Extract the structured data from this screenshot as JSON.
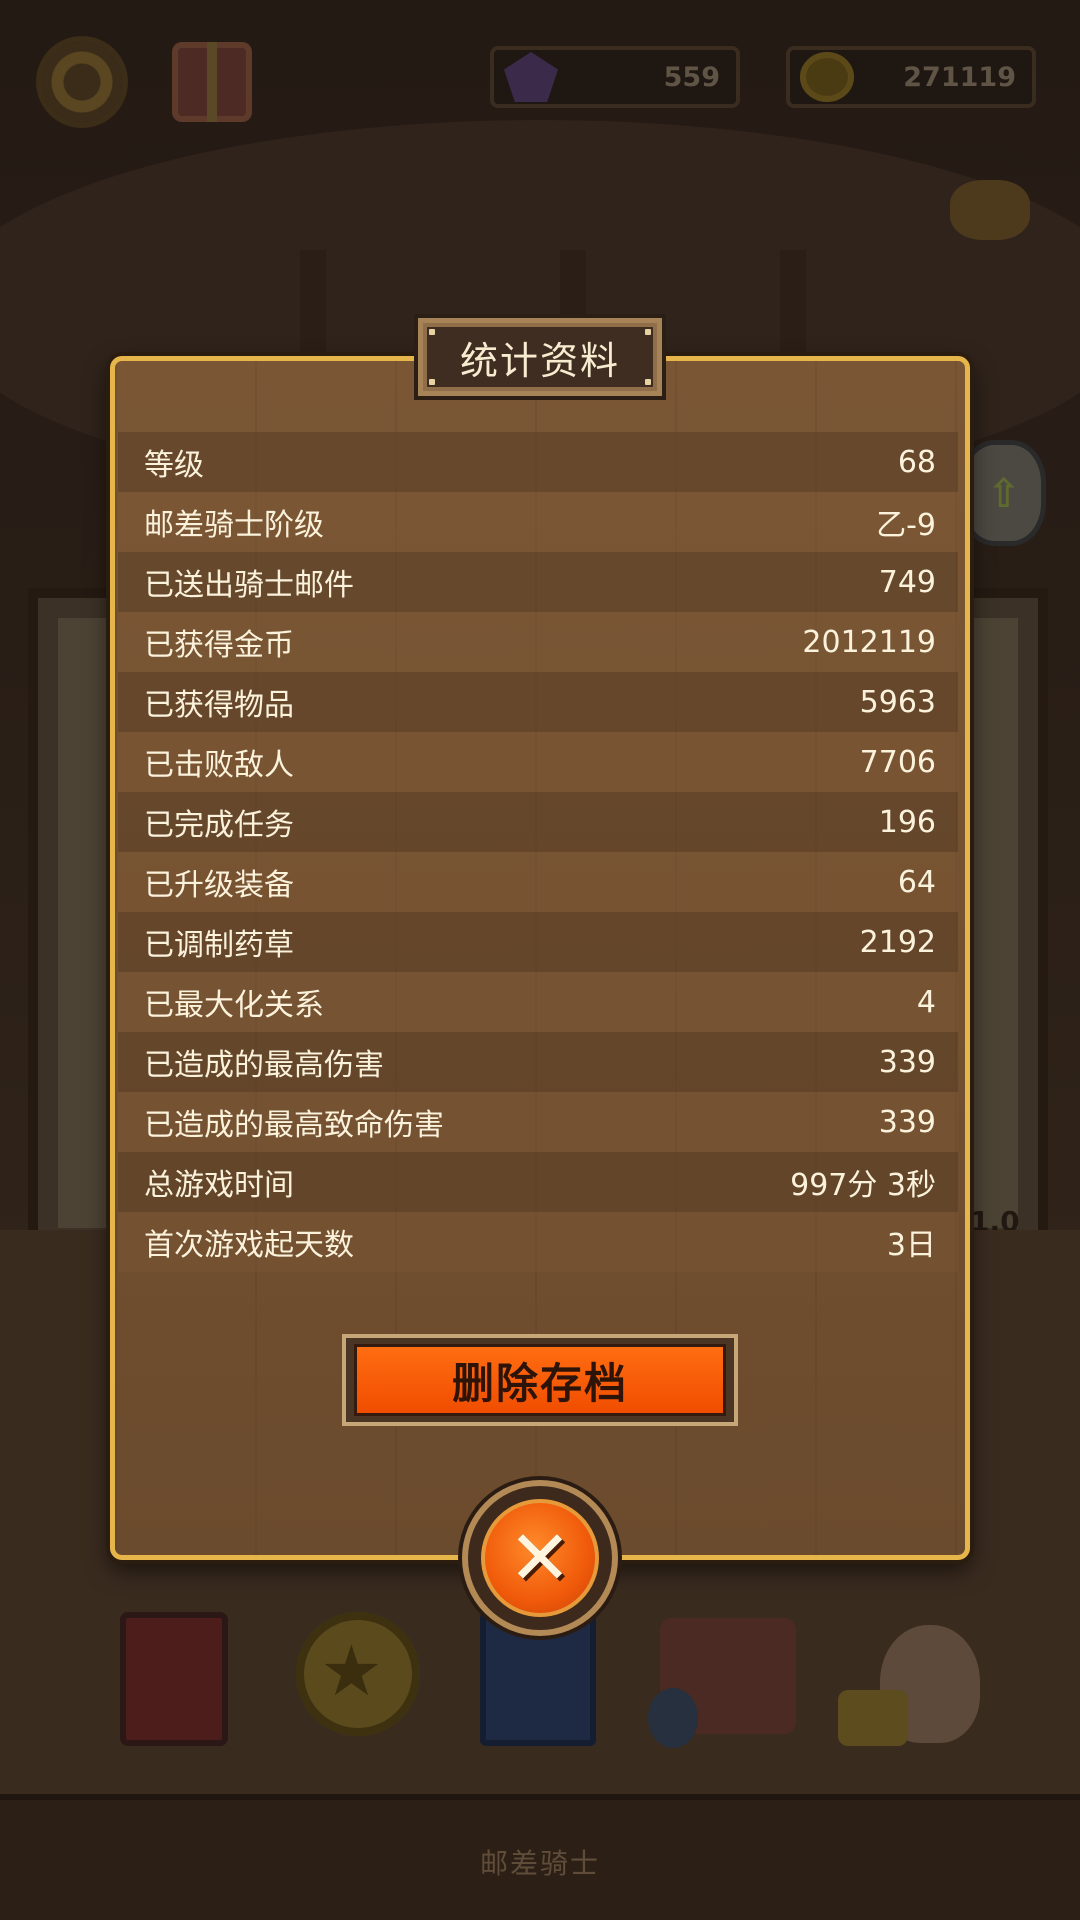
{
  "hud": {
    "gems": "559",
    "gold": "271119"
  },
  "background": {
    "version_text": "1.0",
    "footer_title": "邮差骑士"
  },
  "panel": {
    "title": "统计资料",
    "stats": [
      {
        "label": "等级",
        "value": "68"
      },
      {
        "label": "邮差骑士阶级",
        "value": "乙-9"
      },
      {
        "label": "已送出骑士邮件",
        "value": "749"
      },
      {
        "label": "已获得金币",
        "value": "2012119"
      },
      {
        "label": "已获得物品",
        "value": "5963"
      },
      {
        "label": "已击败敌人",
        "value": "7706"
      },
      {
        "label": "已完成任务",
        "value": "196"
      },
      {
        "label": "已升级装备",
        "value": "64"
      },
      {
        "label": "已调制药草",
        "value": "2192"
      },
      {
        "label": "已最大化关系",
        "value": "4"
      },
      {
        "label": "已造成的最高伤害",
        "value": "339"
      },
      {
        "label": "已造成的最高致命伤害",
        "value": "339"
      },
      {
        "label": "总游戏时间",
        "value": "997分 3秒"
      },
      {
        "label": "首次游戏起天数",
        "value": "3日"
      }
    ],
    "delete_button": "删除存档",
    "close_button_icon": "close-x"
  }
}
